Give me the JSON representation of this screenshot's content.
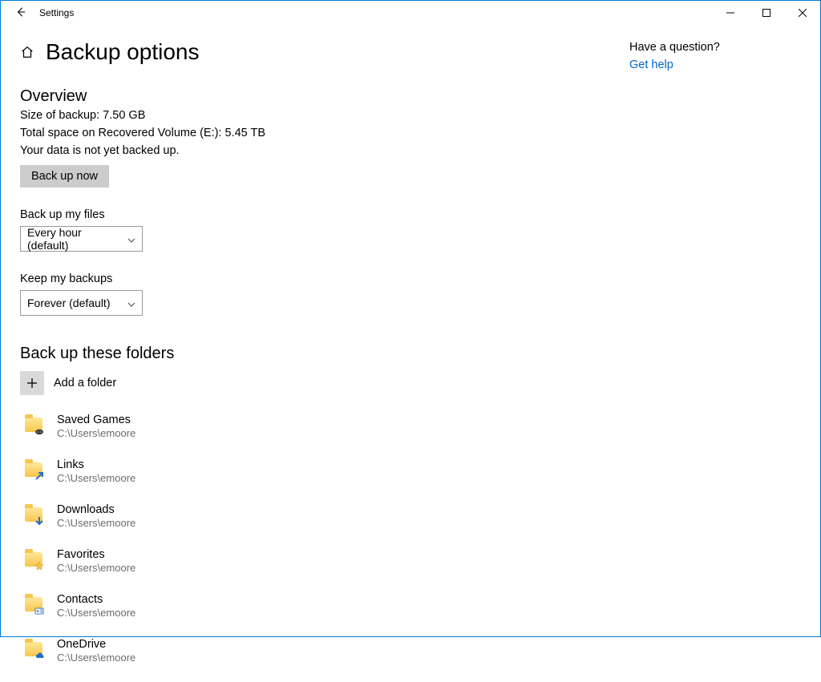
{
  "app": {
    "title": "Settings"
  },
  "page": {
    "title": "Backup options"
  },
  "overview": {
    "head": "Overview",
    "size": "Size of backup: 7.50 GB",
    "space": "Total space on Recovered Volume (E:): 5.45 TB",
    "status": "Your data is not yet backed up.",
    "backup_now": "Back up now"
  },
  "frequency": {
    "label": "Back up my files",
    "value": "Every hour (default)"
  },
  "retention": {
    "label": "Keep my backups",
    "value": "Forever (default)"
  },
  "folders": {
    "head": "Back up these folders",
    "add": "Add a folder",
    "list": [
      {
        "name": "Saved Games",
        "path": "C:\\Users\\emoore",
        "overlay": "controller"
      },
      {
        "name": "Links",
        "path": "C:\\Users\\emoore",
        "overlay": "arrow"
      },
      {
        "name": "Downloads",
        "path": "C:\\Users\\emoore",
        "overlay": "down"
      },
      {
        "name": "Favorites",
        "path": "C:\\Users\\emoore",
        "overlay": "star"
      },
      {
        "name": "Contacts",
        "path": "C:\\Users\\emoore",
        "overlay": "card"
      },
      {
        "name": "OneDrive",
        "path": "C:\\Users\\emoore",
        "overlay": "cloud"
      }
    ]
  },
  "help": {
    "head": "Have a question?",
    "link": "Get help"
  }
}
